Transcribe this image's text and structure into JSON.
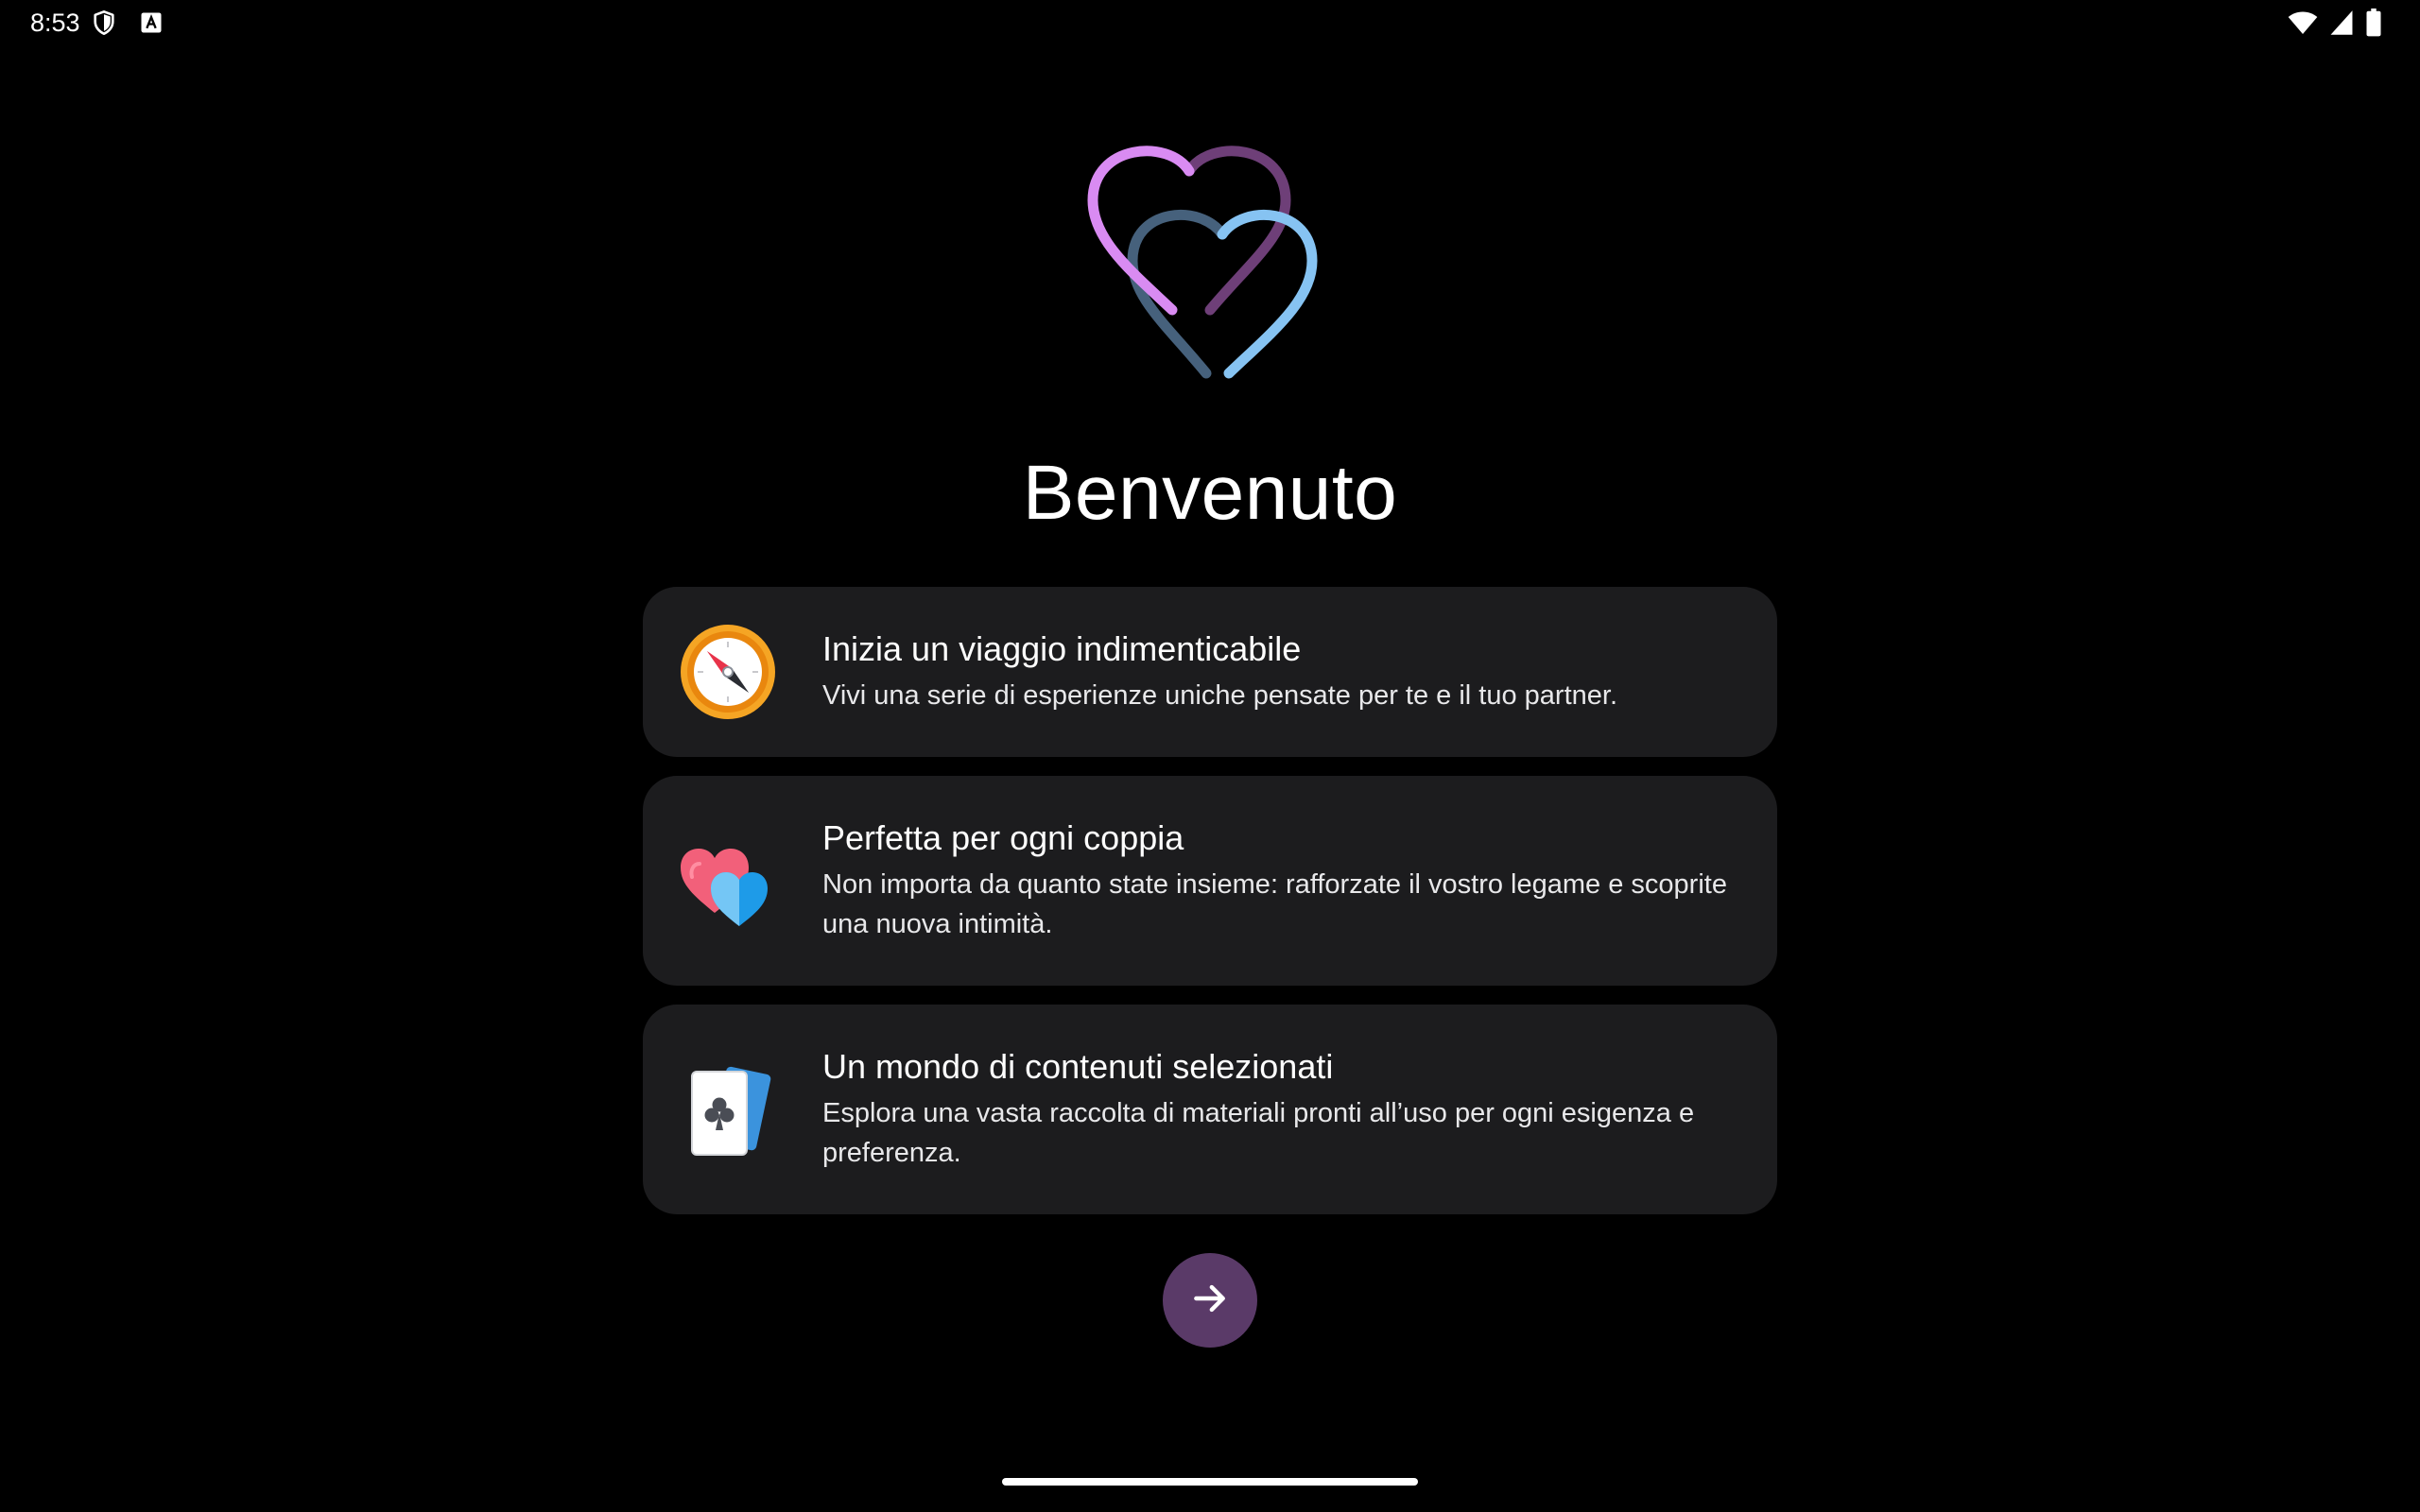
{
  "status_bar": {
    "time": "8:53",
    "left_icons": [
      "shield-icon",
      "keyboard-a-icon"
    ],
    "right_icons": [
      "wifi-icon",
      "cellular-signal-icon",
      "battery-icon"
    ]
  },
  "logo": {
    "icon": "two-hearts-logo-icon",
    "colors": {
      "heart_left_front": "#d98bf2",
      "heart_left_back": "#6e3f78",
      "heart_right_front": "#86c3f2",
      "heart_right_back": "#46617c"
    }
  },
  "welcome": {
    "title": "Benvenuto"
  },
  "features": [
    {
      "icon": "compass-icon",
      "title": "Inizia un viaggio indimenticabile",
      "description": "Vivi una serie di esperienze uniche pensate per te e il tuo partner."
    },
    {
      "icon": "two-hearts-icon",
      "title": "Perfetta per ogni coppia",
      "description": "Non importa da quanto state insieme: rafforzate il vostro legame e scoprite una nuova intimità."
    },
    {
      "icon": "playing-cards-icon",
      "title": "Un mondo di contenuti selezionati",
      "description": "Esplora una vasta raccolta di materiali pronti all’uso per ogni esigenza e preferenza."
    }
  ],
  "next_button": {
    "icon": "arrow-right-icon",
    "color": "#5a3a68"
  },
  "theme": {
    "background": "#000000",
    "card_background": "#1c1c1e",
    "text_primary": "#ffffff"
  }
}
